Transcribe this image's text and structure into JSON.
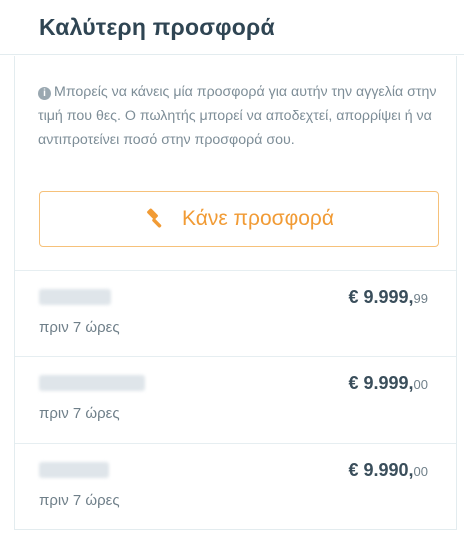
{
  "header": {
    "title": "Καλύτερη προσφορά"
  },
  "info": {
    "icon": "info-circle-icon",
    "text": "Μπορείς να κάνεις μία προσφορά για αυτήν την αγγελία στην τιμή που θες. Ο πωλητής μπορεί να αποδεχτεί, απορρίψει ή να αντιπροτείνει ποσό στην προσφορά σου."
  },
  "offer_button": {
    "label": "Κάνε προσφορά",
    "icon": "gavel-icon",
    "border_color": "#f6c17a",
    "text_color": "#f19b35"
  },
  "bids": [
    {
      "price_main": "€ 9.999,",
      "price_cents": "99",
      "time": "πριν 7 ώρες"
    },
    {
      "price_main": "€ 9.999,",
      "price_cents": "00",
      "time": "πριν 7 ώρες"
    },
    {
      "price_main": "€ 9.990,",
      "price_cents": "00",
      "time": "πριν 7 ώρες"
    }
  ]
}
